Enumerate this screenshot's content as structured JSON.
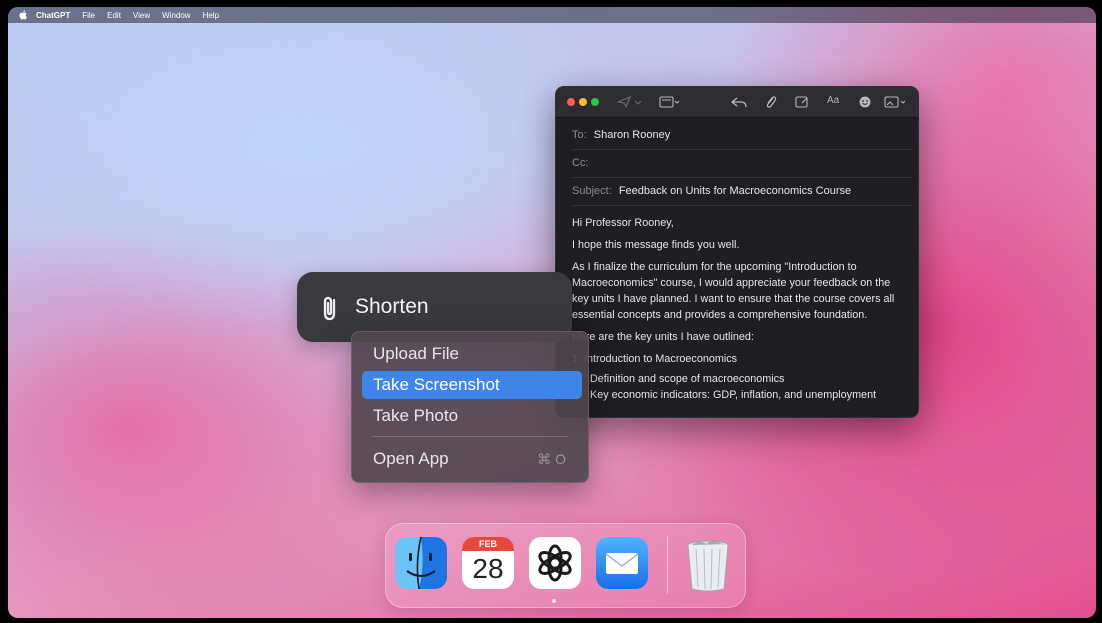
{
  "menubar": {
    "app_name": "ChatGPT",
    "items": [
      "File",
      "Edit",
      "View",
      "Window",
      "Help"
    ]
  },
  "shorten": {
    "label": "Shorten"
  },
  "context_menu": {
    "items": [
      {
        "label": "Upload File",
        "selected": false
      },
      {
        "label": "Take Screenshot",
        "selected": true
      },
      {
        "label": "Take Photo",
        "selected": false
      }
    ],
    "open_app": {
      "label": "Open App",
      "shortcut": "⌘ O"
    }
  },
  "mail": {
    "to_label": "To:",
    "to_value": "Sharon Rooney",
    "cc_label": "Cc:",
    "subject_label": "Subject:",
    "subject_value": "Feedback on Units for Macroeconomics Course",
    "greeting": "Hi Professor Rooney,",
    "p1": "I hope this message finds you well.",
    "p2": "As I finalize the curriculum for the upcoming \"Introduction to Macroeconomics\" course, I would appreciate your feedback on the key units I have planned. I want to ensure that the course covers all essential concepts and provides a comprehensive foundation.",
    "p3": "Here are the key units I have outlined:",
    "unit1": "1. Introduction to Macroeconomics",
    "bullets": [
      "Definition and scope of macroeconomics",
      "Key economic indicators: GDP, inflation, and unemployment"
    ],
    "toolbar_icons": [
      "send-icon",
      "header-fields-icon",
      "reply-icon",
      "attachment-icon",
      "markup-icon",
      "format-text-icon",
      "emoji-icon",
      "photo-browser-icon"
    ],
    "format_label": "Aa"
  },
  "dock": {
    "apps": [
      "finder-icon",
      "calendar-icon",
      "chatgpt-icon",
      "mail-icon",
      "trash-icon"
    ],
    "calendar_month": "FEB",
    "calendar_day": "28"
  },
  "colors": {
    "selection": "#3d86e8",
    "traffic_red": "#ff5f57",
    "traffic_yellow": "#febc2e",
    "traffic_green": "#28c840"
  }
}
